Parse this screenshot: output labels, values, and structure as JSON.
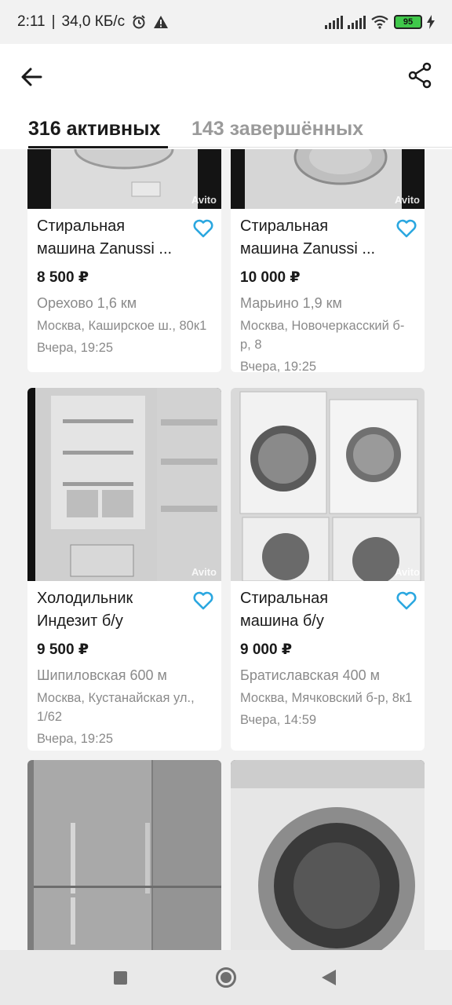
{
  "status_bar": {
    "time": "2:11",
    "speed": "34,0 КБ/с",
    "battery": "95"
  },
  "tabs": {
    "active": "316 активных",
    "inactive": "143 завершённых"
  },
  "watermark": "Avito",
  "cards": [
    {
      "title": "Стиральная машина Zanussi ...",
      "price": "8 500 ₽",
      "metro": "Орехово 1,6 км",
      "address": "Москва, Каширское ш., 80к1",
      "date": "Вчера, 19:25"
    },
    {
      "title": "Стиральная машина Zanussi ...",
      "price": "10 000 ₽",
      "metro": "Марьино 1,9 км",
      "address": "Москва, Новочеркасский б-р, 8",
      "date": "Вчера, 19:25"
    },
    {
      "title": "Холодильник Индезит б/у",
      "price": "9 500 ₽",
      "metro": "Шипиловская 600 м",
      "address": "Москва, Кустанайская ул., 1/62",
      "date": "Вчера, 19:25"
    },
    {
      "title": "Стиральная машина б/у",
      "price": "9 000 ₽",
      "metro": "Братиславская 400 м",
      "address": "Москва, Мячковский б-р, 8к1",
      "date": "Вчера, 14:59"
    }
  ],
  "colors": {
    "favorite": "#2ba7e0",
    "price": "#1a1a1a",
    "muted": "#8a8a8a"
  },
  "icons": {
    "back": "arrow-left-icon",
    "share": "share-icon",
    "favorite": "heart-outline-icon"
  }
}
